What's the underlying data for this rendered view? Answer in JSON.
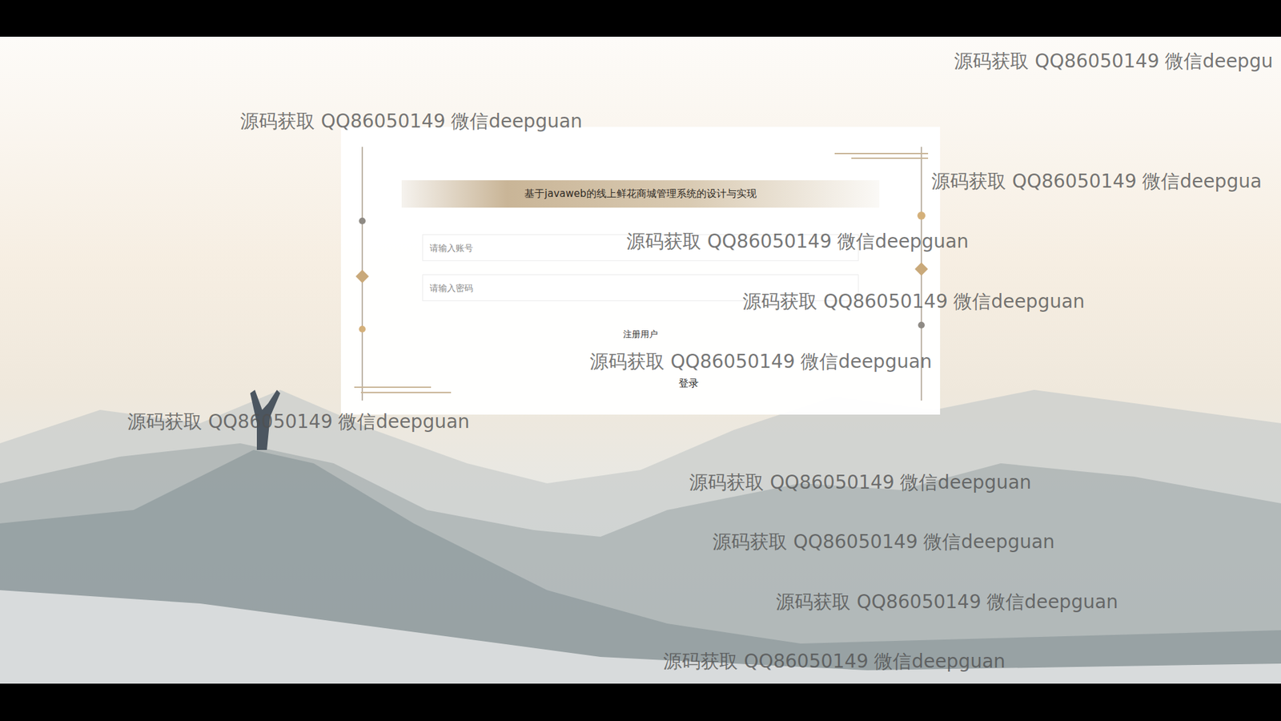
{
  "title": "基于javaweb的线上鲜花商城管理系统的设计与实现",
  "fields": [
    {
      "placeholder": "请输入账号"
    },
    {
      "placeholder": "请输入密码"
    }
  ],
  "links": [
    "注册用户"
  ],
  "buttons": [
    "登录"
  ],
  "watermarks": [
    "源码获取 QQ86050149 微信deepgu",
    "源码获取 QQ86050149 微信deepguan",
    "源码获取 QQ86050149 微信deepgua",
    "源码获取 QQ86050149 微信deepguan",
    "源码获取 QQ86050149 微信deepguan",
    "源码获取 QQ86050149 微信deepguan",
    "源码获取 QQ86050149 微信deepguan",
    "源码获取 QQ86050149 微信deepguan",
    "源码获取 QQ86050149 微信deepguan",
    "源码获取 QQ86050149 微信deepguan",
    "源码获取 QQ86050149 微信deepguan"
  ]
}
